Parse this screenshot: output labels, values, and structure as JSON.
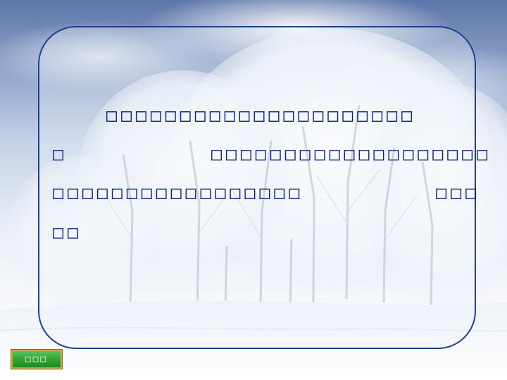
{
  "slide": {
    "text_lines": [
      "□□□□□□□□□□□□□□□□□□□□□",
      "□□□□□□□□□□□□□□□□□□□□",
      "□□□□□□□□□□□□□□□□□□□□",
      "□□"
    ],
    "nav_button_label": "□□□"
  }
}
